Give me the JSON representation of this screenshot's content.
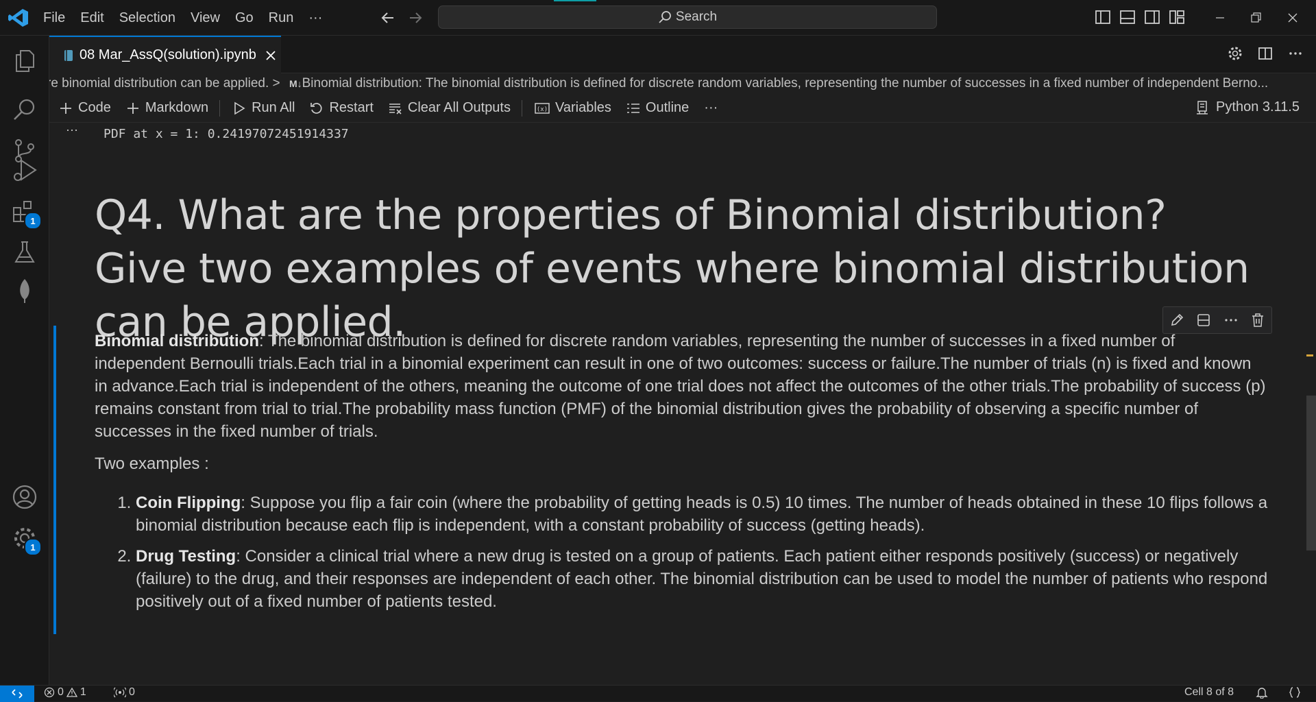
{
  "menu": [
    "File",
    "Edit",
    "Selection",
    "View",
    "Go",
    "Run",
    "···"
  ],
  "search": {
    "label": "Search"
  },
  "tab": {
    "label": "08 Mar_AssQ(solution).ipynb"
  },
  "breadcrumb": {
    "part1": "re binomial distribution can be applied.",
    "separator": ">",
    "md_badge": "M↓",
    "part2": "Binomial distribution: The binomial distribution is defined for discrete random variables, representing the number of successes in a fixed number of independent Berno..."
  },
  "toolbar": {
    "code": "Code",
    "markdown": "Markdown",
    "run_all": "Run All",
    "restart": "Restart",
    "clear_outputs": "Clear All Outputs",
    "variables": "Variables",
    "outline": "Outline",
    "more": "···",
    "kernel": "Python 3.11.5"
  },
  "output": {
    "dots": "···",
    "text": "PDF at x = 1: 0.24197072451914337"
  },
  "heading": "Q4. What are the properties of Binomial distribution? Give two examples of events where binomial distribution can be applied.",
  "cell": {
    "def_term": "Binomial distribution",
    "def_text": ": The binomial distribution is defined for discrete random variables, representing the number of successes in a fixed number of independent Bernoulli trials.Each trial in a binomial experiment can result in one of two outcomes: success or failure.The number of trials (n) is fixed and known in advance.Each trial is independent of the others, meaning the outcome of one trial does not affect the outcomes of the other trials.The probability of success (p) remains constant from trial to trial.The probability mass function (PMF) of the binomial distribution gives the probability of observing a specific number of successes in the fixed number of trials.",
    "examples_intro": "Two examples :",
    "examples": [
      {
        "term": "Coin Flipping",
        "text": ": Suppose you flip a fair coin (where the probability of getting heads is 0.5) 10 times. The number of heads obtained in these 10 flips follows a binomial distribution because each flip is independent, with a constant probability of success (getting heads)."
      },
      {
        "term": "Drug Testing",
        "text": ": Consider a clinical trial where a new drug is tested on a group of patients. Each patient either responds positively (success) or negatively (failure) to the drug, and their responses are independent of each other. The binomial distribution can be used to model the number of patients who respond positively out of a fixed number of patients tested."
      }
    ]
  },
  "activity_badges": {
    "extensions": "1",
    "settings": "1"
  },
  "status": {
    "errors": "0",
    "warnings": "1",
    "ports": "0",
    "cell_position": "Cell 8 of 8"
  },
  "colors": {
    "accent": "#0078d4",
    "background": "#1f1f1f",
    "chrome": "#181818",
    "badge": "#0078d4"
  },
  "icons": [
    "vscode-logo-icon",
    "arrow-left-icon",
    "arrow-right-icon",
    "search-icon",
    "explorer-icon",
    "search-view-icon",
    "source-control-icon",
    "run-debug-icon",
    "extensions-icon",
    "testing-icon",
    "mongodb-leaf-icon",
    "account-icon",
    "settings-gear-icon",
    "notebook-file-icon",
    "close-icon",
    "split-editor-icon",
    "plus-icon",
    "play-icon",
    "restart-icon",
    "clear-outputs-icon",
    "variables-icon",
    "outline-icon",
    "kernel-icon",
    "edit-pencil-icon",
    "split-cell-icon",
    "trash-icon",
    "remote-icon",
    "error-icon",
    "warning-icon",
    "ports-icon",
    "bell-icon",
    "braces-icon"
  ]
}
